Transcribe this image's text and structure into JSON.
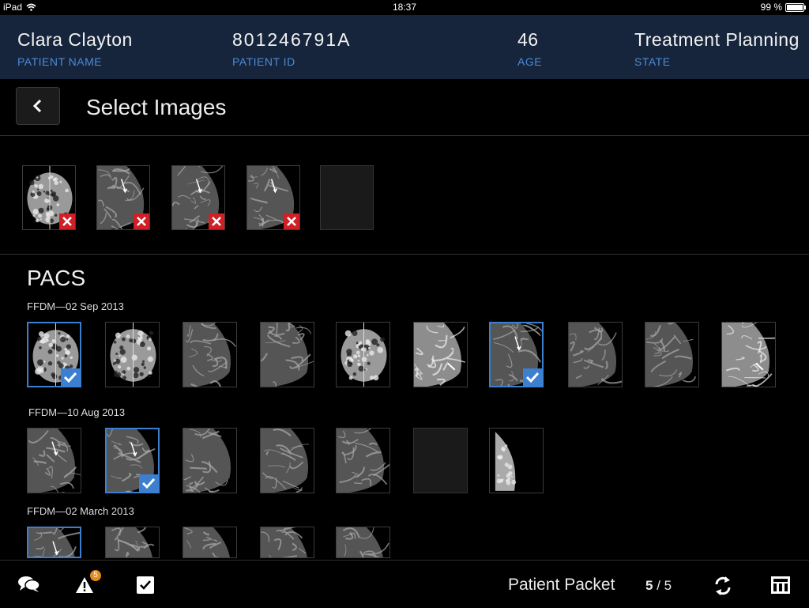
{
  "status_bar": {
    "device": "iPad",
    "time": "18:37",
    "battery": "99 %",
    "battery_level": 0.99
  },
  "patient": {
    "name": "Clara Clayton",
    "name_label": "PATIENT NAME",
    "id": "801246791A",
    "id_label": "PATIENT ID",
    "age": "46",
    "age_label": "AGE",
    "state": "Treatment Planning",
    "state_label": "STATE"
  },
  "title": "Select Images",
  "selected_tray": [
    {
      "kind": "ap"
    },
    {
      "kind": "mlo"
    },
    {
      "kind": "mlo"
    },
    {
      "kind": "mlo"
    },
    {
      "kind": "empty"
    }
  ],
  "pacs": {
    "heading": "PACS",
    "groups": [
      {
        "label": "FFDM—02 Sep 2013",
        "images": [
          {
            "kind": "ap",
            "checked": true
          },
          {
            "kind": "ap",
            "checked": false
          },
          {
            "kind": "cc",
            "checked": false
          },
          {
            "kind": "cc",
            "checked": false
          },
          {
            "kind": "ap",
            "checked": false
          },
          {
            "kind": "bright",
            "checked": false
          },
          {
            "kind": "mlo",
            "checked": true
          },
          {
            "kind": "cc",
            "checked": false
          },
          {
            "kind": "cc",
            "checked": false
          },
          {
            "kind": "bright",
            "checked": false
          }
        ]
      },
      {
        "label": "FFDM—10 Aug 2013",
        "images": [
          {
            "kind": "mlo",
            "checked": false
          },
          {
            "kind": "mlo",
            "checked": true
          },
          {
            "kind": "cc",
            "checked": false
          },
          {
            "kind": "cc",
            "checked": false
          },
          {
            "kind": "cc",
            "checked": false
          },
          {
            "kind": "empty",
            "checked": false
          },
          {
            "kind": "side",
            "checked": false
          }
        ]
      },
      {
        "label": "FFDM—02 March 2013",
        "images": [
          {
            "kind": "mlo",
            "checked": false,
            "highlight": true
          },
          {
            "kind": "cc",
            "checked": false
          },
          {
            "kind": "cc",
            "checked": false
          },
          {
            "kind": "cc",
            "checked": false
          },
          {
            "kind": "cc",
            "checked": false
          }
        ]
      }
    ]
  },
  "bottom_bar": {
    "alerts_count": "5",
    "packet_label": "Patient Packet",
    "packet_current": "5",
    "packet_total": "5"
  },
  "colors": {
    "accent": "#3c7fd1",
    "remove": "#d11f26",
    "header_bg": "#16253c",
    "label": "#4b8ad6",
    "badge": "#e68a1a"
  }
}
